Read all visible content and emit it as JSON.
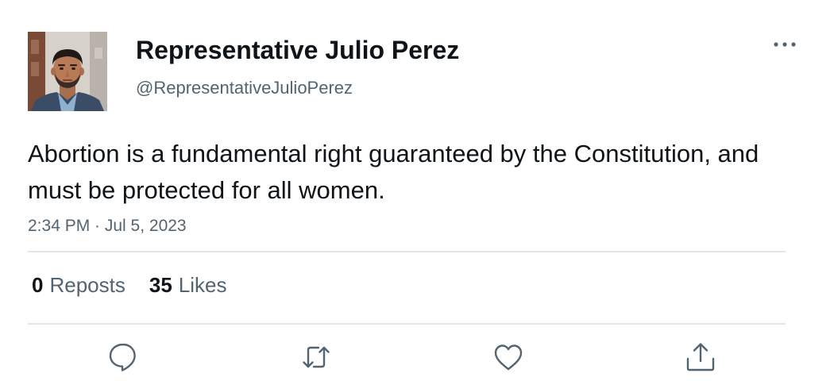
{
  "author": {
    "display_name": "Representative Julio Perez",
    "handle": "@RepresentativeJulioPerez",
    "avatar_icon": "profile-photo"
  },
  "post": {
    "text": "Abortion is a fundamental right guaranteed by the Constitution, and must be protected for all women.",
    "timestamp": "2:34 PM · Jul 5, 2023"
  },
  "stats": {
    "reposts_count": "0",
    "reposts_label": "Reposts",
    "likes_count": "35",
    "likes_label": "Likes"
  },
  "actions": {
    "reply_icon": "speech-bubble-icon",
    "repost_icon": "repost-arrows-icon",
    "like_icon": "heart-icon",
    "share_icon": "share-arrow-icon",
    "more_icon": "ellipsis-icon"
  },
  "colors": {
    "text_primary": "#0f1419",
    "text_secondary": "#536471",
    "divider": "#e3e6e8"
  }
}
